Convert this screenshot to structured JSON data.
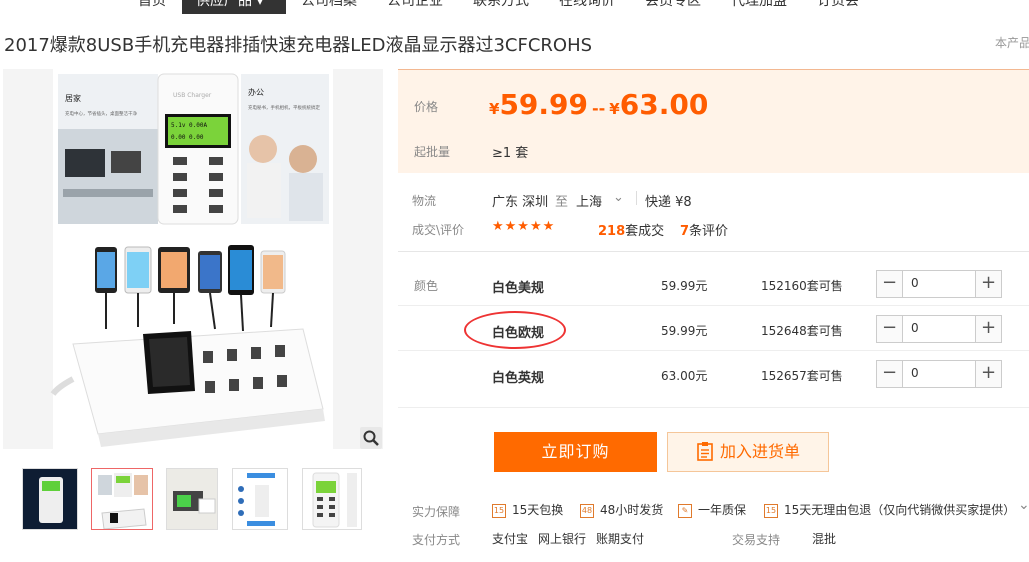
{
  "nav": {
    "items": [
      "首页",
      "供应产品",
      "公司档案",
      "公司企业",
      "联系方式",
      "在线询价",
      "会员专区",
      "代理加盟",
      "订货会"
    ],
    "active_index": 1,
    "active_caret": "▾"
  },
  "product": {
    "title": "2017爆款8USB手机充电器排插快速充电器LED液晶显示器过3CFCROHS",
    "title_right": "本产品"
  },
  "image": {
    "panel_left_title": "居家",
    "panel_left_text": "充电中心，节省插头，桌面整洁干净",
    "panel_right_title": "办公",
    "panel_right_text": "充电秘书，手机相机，平板统统搞定",
    "device_brand": "USB Charger",
    "lcd_line1": "5.1v  0.00A",
    "lcd_line2": "0.00  0.00",
    "thumbs_count": 5,
    "active_thumb": 1
  },
  "price": {
    "label": "价格",
    "currency": "¥",
    "low": "59.99",
    "dash": "--",
    "high": "63.00",
    "moq_label": "起批量",
    "moq_value": "≥1 套"
  },
  "logistics": {
    "label": "物流",
    "from": "广东 深圳",
    "to_word": "至",
    "to": "上海",
    "express": "快递 ¥8",
    "review_label": "成交\\评价",
    "stars": "★★★★★",
    "sold_count": "218",
    "sold_unit": "套成交",
    "review_count": "7",
    "review_unit": "条评价"
  },
  "sku": {
    "label": "颜色",
    "rows": [
      {
        "name": "白色美规",
        "price": "59.99元",
        "stock": "152160套可售",
        "qty": "0"
      },
      {
        "name": "白色欧规",
        "price": "59.99元",
        "stock": "152648套可售",
        "qty": "0"
      },
      {
        "name": "白色英规",
        "price": "63.00元",
        "stock": "152657套可售",
        "qty": "0"
      }
    ],
    "minus": "−",
    "plus": "+"
  },
  "actions": {
    "buy": "立即订购",
    "cart": "加入进货单"
  },
  "guarantee": {
    "label": "实力保障",
    "items": [
      "15天包换",
      "48小时发货",
      "一年质保",
      "15天无理由包退（仅向代销微供买家提供）"
    ],
    "icons": [
      "15",
      "48",
      "✎",
      "15"
    ],
    "more_chevron": "⌄"
  },
  "payment": {
    "label": "支付方式",
    "methods": [
      "支付宝",
      "网上银行",
      "账期支付"
    ],
    "trade_label": "交易支持",
    "trade_value": "混批"
  },
  "colors": {
    "accent": "#ff6a00",
    "price": "#ff5c00",
    "circle": "#e33333"
  }
}
